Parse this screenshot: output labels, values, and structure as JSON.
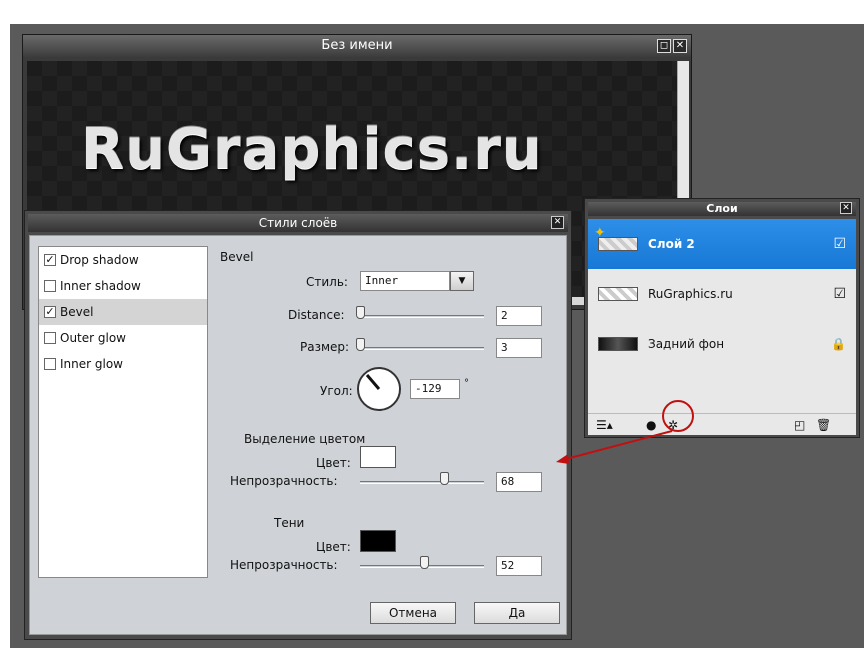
{
  "image_window": {
    "title": "Без имени",
    "restore_glyph": "◻",
    "close_glyph": "✕",
    "canvas_text": "RuGraphics.ru"
  },
  "style_dialog": {
    "title": "Стили слоёв",
    "close_glyph": "✕",
    "style_list": [
      {
        "label": "Drop shadow",
        "checked": true
      },
      {
        "label": "Inner shadow",
        "checked": false
      },
      {
        "label": "Bevel",
        "checked": true
      },
      {
        "label": "Outer glow",
        "checked": false
      },
      {
        "label": "Inner glow",
        "checked": false
      }
    ],
    "check_glyph": "✓",
    "section_title": "Bevel",
    "style_label": "Стиль:",
    "style_value": "Inner",
    "distance_label": "Distance:",
    "distance_value": "2",
    "size_label": "Размер:",
    "size_value": "3",
    "angle_label": "Угол:",
    "angle_value": "-129",
    "angle_unit": "°",
    "highlight_title": "Выделение цветом",
    "highlight_color_label": "Цвет:",
    "highlight_color": "#ffffff",
    "highlight_opacity_label": "Непрозрачность:",
    "highlight_opacity_value": "68",
    "shadow_title": "Тени",
    "shadow_color_label": "Цвет:",
    "shadow_color": "#000000",
    "shadow_opacity_label": "Непрозрачность:",
    "shadow_opacity_value": "52",
    "cancel_label": "Отмена",
    "ok_label": "Да"
  },
  "layers_panel": {
    "title": "Слои",
    "close_glyph": "✕",
    "layers": [
      {
        "name": "Слой 2",
        "selected": true,
        "status": "☑"
      },
      {
        "name": "RuGraphics.ru",
        "selected": false,
        "status": "☑"
      },
      {
        "name": "Задний фон",
        "selected": false,
        "status": "🔒"
      }
    ],
    "accent_color": "#1878d6",
    "annotation_color": "#c01010"
  }
}
